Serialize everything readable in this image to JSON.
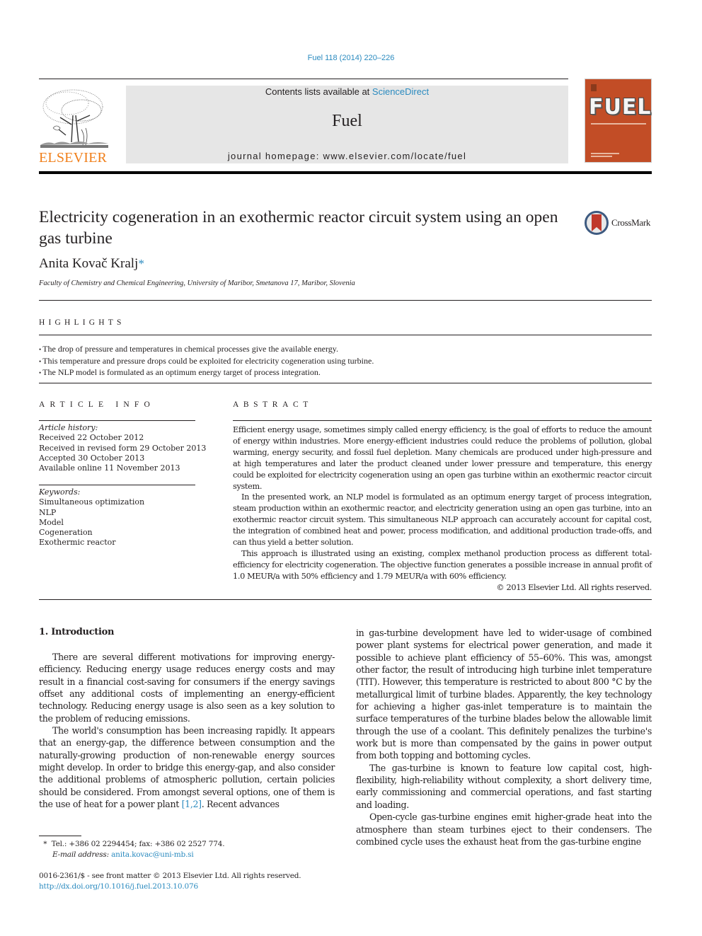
{
  "header": {
    "citation": "Fuel 118 (2014) 220–226",
    "contents_prefix": "Contents lists available at ",
    "contents_link": "ScienceDirect",
    "journal_name": "Fuel",
    "homepage": "journal homepage: www.elsevier.com/locate/fuel",
    "publisher_logo_text": "ELSEVIER",
    "cover_title": "FUEL",
    "crossmark_label": "CrossMark"
  },
  "article": {
    "title": "Electricity cogeneration in an exothermic reactor circuit system using an open gas turbine",
    "author": "Anita Kovač Kralj",
    "author_mark": "*",
    "affiliation": "Faculty of Chemistry and Chemical Engineering, University of Maribor, Smetanova 17, Maribor, Slovenia"
  },
  "highlights": {
    "heading": "HIGHLIGHTS",
    "items": [
      "The drop of pressure and temperatures in chemical processes give the available energy.",
      "This temperature and pressure drops could be exploited for electricity cogeneration using turbine.",
      "The NLP model is formulated as an optimum energy target of process integration."
    ]
  },
  "article_info": {
    "heading": "ARTICLE INFO",
    "history_label": "Article history:",
    "history": [
      "Received 22 October 2012",
      "Received in revised form 29 October 2013",
      "Accepted 30 October 2013",
      "Available online 11 November 2013"
    ],
    "keywords_label": "Keywords:",
    "keywords": [
      "Simultaneous optimization",
      "NLP",
      "Model",
      "Cogeneration",
      "Exothermic reactor"
    ]
  },
  "abstract": {
    "heading": "ABSTRACT",
    "paragraphs": [
      "Efficient energy usage, sometimes simply called energy efficiency, is the goal of efforts to reduce the amount of energy within industries. More energy-efficient industries could reduce the problems of pollution, global warming, energy security, and fossil fuel depletion. Many chemicals are produced under high-pressure and at high temperatures and later the product cleaned under lower pressure and temperature, this energy could be exploited for electricity cogeneration using an open gas turbine within an exothermic reactor circuit system.",
      "In the presented work, an NLP model is formulated as an optimum energy target of process integration, steam production within an exothermic reactor, and electricity generation using an open gas turbine, into an exothermic reactor circuit system. This simultaneous NLP approach can accurately account for capital cost, the integration of combined heat and power, process modification, and additional production trade-offs, and can thus yield a better solution.",
      "This approach is illustrated using an existing, complex methanol production process as different total-efficiency for electricity cogeneration. The objective function generates a possible increase in annual profit of 1.0 MEUR/a with 50% efficiency and 1.79 MEUR/a with 60% efficiency."
    ],
    "copyright": "© 2013 Elsevier Ltd. All rights reserved."
  },
  "introduction": {
    "heading": "1. Introduction",
    "left_paragraphs": [
      "There are several different motivations for improving energy-efficiency. Reducing energy usage reduces energy costs and may result in a financial cost-saving for consumers if the energy savings offset any additional costs of implementing an energy-efficient technology. Reducing energy usage is also seen as a key solution to the problem of reducing emissions.",
      "The world's consumption has been increasing rapidly. It appears that an energy-gap, the difference between consumption and the naturally-growing production of non-renewable energy sources might develop. In order to bridge this energy-gap, and also consider the additional problems of atmospheric pollution, certain policies should be considered. From amongst several options, one of them is the use of heat for a power plant "
    ],
    "ref_link": "[1,2]",
    "left_tail": ". Recent advances",
    "right_paragraphs": [
      "in gas-turbine development have led to wider-usage of combined power plant systems for electrical power generation, and made it possible to achieve plant efficiency of 55–60%. This was, amongst other factor, the result of introducing high turbine inlet temperature (TIT). However, this temperature is restricted to about 800 °C by the metallurgical limit of turbine blades. Apparently, the key technology for achieving a higher gas-inlet temperature is to maintain the surface temperatures of the turbine blades below the allowable limit through the use of a coolant. This definitely penalizes the turbine's work but is more than compensated by the gains in power output from both topping and bottoming cycles.",
      "The gas-turbine is known to feature low capital cost, high-flexibility, high-reliability without complexity, a short delivery time, early commissioning and commercial operations, and fast starting and loading.",
      "Open-cycle gas-turbine engines emit higher-grade heat into the atmosphere than steam turbines eject to their condensers. The combined cycle uses the exhaust heat from the gas-turbine engine"
    ]
  },
  "footnotes": {
    "mark": "*",
    "contact": "Tel.: +386 02 2294454; fax: +386 02 2527 774.",
    "email_label": "E-mail address:",
    "email": "anita.kovac@uni-mb.si",
    "issn_line": "0016-2361/$ - see front matter © 2013 Elsevier Ltd. All rights reserved.",
    "doi": "http://dx.doi.org/10.1016/j.fuel.2013.10.076"
  }
}
